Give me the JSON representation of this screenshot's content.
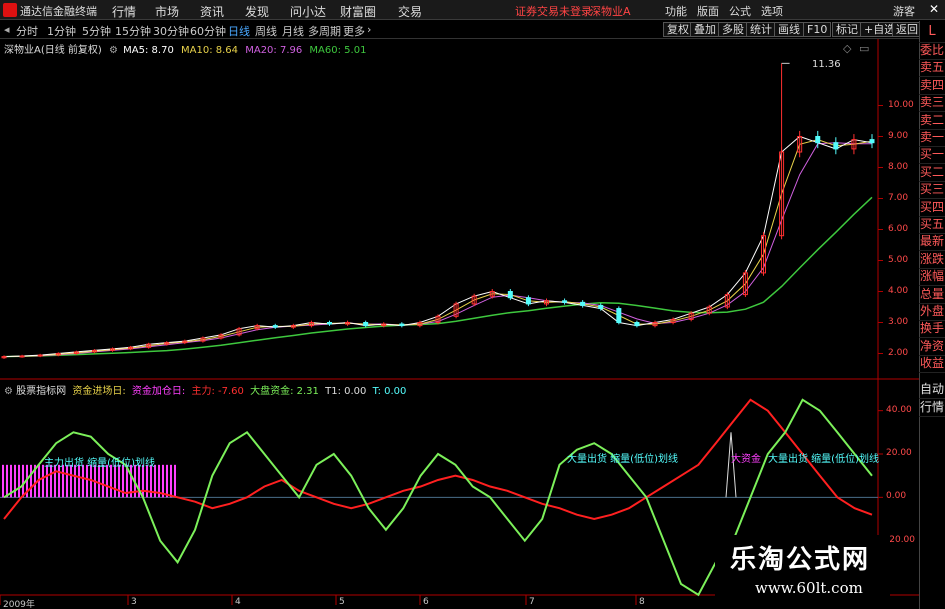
{
  "menubar": {
    "app_title": "通达信金融终端",
    "items": [
      "行情",
      "市场",
      "资讯",
      "发现",
      "问小达",
      "财富圈",
      "交易"
    ],
    "warning": "证券交易未登录",
    "stock": "深物业A",
    "right_items": [
      "功能",
      "版面",
      "公式",
      "选项",
      "游客"
    ]
  },
  "periodbar": {
    "periods": [
      "分时",
      "1分钟",
      "5分钟",
      "15分钟",
      "30分钟",
      "60分钟",
      "日线",
      "周线",
      "月线",
      "多周期",
      "更多"
    ],
    "active": "日线",
    "tools": [
      "复权",
      "叠加",
      "多股",
      "统计",
      "画线",
      "F10",
      "标记",
      "+自选",
      "返回"
    ]
  },
  "sidebar": {
    "top": "L",
    "items": [
      "委比",
      "卖五",
      "卖四",
      "卖三",
      "卖二",
      "卖一",
      "买一",
      "买二",
      "买三",
      "买四",
      "买五",
      "最新",
      "涨跌",
      "涨幅",
      "总量",
      "外盘",
      "换手",
      "净资",
      "收益"
    ],
    "bottom_items": [
      "自动",
      "行情"
    ]
  },
  "main_legend": {
    "title": "深物业A(日线 前复权)",
    "ma5": "MA5: 8.70",
    "ma10": "MA10: 8.64",
    "ma20": "MA20: 7.96",
    "ma60": "MA60: 5.01"
  },
  "peak_label": "11.36",
  "indicator_legend": {
    "title": "股票指标网",
    "f1": "资金进场日:",
    "f2": "资金加仓日:",
    "f3": "主力: -7.60",
    "f4": "大盘资金: 2.31",
    "f5": "T1: 0.00",
    "f6": "T: 0.00"
  },
  "annotations": {
    "a1": "主力出货 缩量(低位)划线",
    "a2": "大量出货 缩量(低位)划线",
    "a3": "大资金",
    "a4": "大量出货 缩量(低位)划线"
  },
  "main_yticks": [
    "10.00",
    "9.00",
    "8.00",
    "7.00",
    "6.00",
    "5.00",
    "4.00",
    "3.00",
    "2.00"
  ],
  "ind_yticks": [
    "40.00",
    "20.00",
    "0.00",
    "-20.00"
  ],
  "xticks": [
    "2009年",
    "3",
    "4",
    "5",
    "6",
    "7",
    "8"
  ],
  "watermark": {
    "cn": "乐淘公式网",
    "url": "www.60lt.com"
  },
  "colors": {
    "up": "#ff3030",
    "down": "#54fcfc",
    "ma5": "#ffffff",
    "ma10": "#e8d24a",
    "ma20": "#d060e0",
    "ma60": "#3ec83e",
    "main_line": "#7cf05a",
    "sub_line": "#ff2020",
    "fund_bar": "#ff40ff"
  },
  "chart_data": {
    "type": "line",
    "title": "深物业A(日线 前复权)",
    "ylim": [
      1.5,
      11.5
    ],
    "close_series": {
      "name": "深物业A",
      "values": [
        1.9,
        1.92,
        1.95,
        2.0,
        2.05,
        2.1,
        2.15,
        2.2,
        2.3,
        2.35,
        2.4,
        2.5,
        2.6,
        2.8,
        2.9,
        2.85,
        2.9,
        3.0,
        2.95,
        3.0,
        2.9,
        2.95,
        2.9,
        3.0,
        3.2,
        3.6,
        3.85,
        4.0,
        3.8,
        3.6,
        3.7,
        3.65,
        3.55,
        3.45,
        3.0,
        2.9,
        3.0,
        3.1,
        3.3,
        3.5,
        3.9,
        4.6,
        5.8,
        8.5,
        9.0,
        8.8,
        8.6,
        8.9,
        8.8
      ]
    },
    "ma_series": [
      {
        "name": "MA5",
        "last": 8.7
      },
      {
        "name": "MA10",
        "last": 8.64
      },
      {
        "name": "MA20",
        "last": 7.96
      },
      {
        "name": "MA60",
        "last": 5.01
      }
    ],
    "indicator": {
      "ylim": [
        -40,
        50
      ],
      "green": [
        0,
        5,
        15,
        25,
        30,
        28,
        20,
        15,
        0,
        -20,
        -30,
        -15,
        10,
        25,
        30,
        20,
        10,
        0,
        15,
        20,
        10,
        -5,
        -15,
        -5,
        10,
        20,
        15,
        5,
        0,
        -10,
        -20,
        -10,
        15,
        22,
        25,
        20,
        10,
        0,
        -20,
        -40,
        -45,
        -30,
        -20,
        0,
        20,
        30,
        45,
        40,
        30,
        20,
        10
      ],
      "red": [
        -10,
        0,
        8,
        12,
        10,
        8,
        5,
        2,
        3,
        2,
        0,
        -2,
        -5,
        -3,
        0,
        5,
        8,
        3,
        0,
        -3,
        -5,
        -3,
        0,
        3,
        5,
        8,
        10,
        8,
        5,
        3,
        0,
        -3,
        -5,
        -8,
        -10,
        -8,
        -5,
        0,
        5,
        10,
        15,
        25,
        35,
        45,
        40,
        30,
        20,
        10,
        0,
        -5,
        -8
      ]
    },
    "xticks": [
      "2009年",
      "3",
      "4",
      "5",
      "6",
      "7",
      "8"
    ]
  }
}
